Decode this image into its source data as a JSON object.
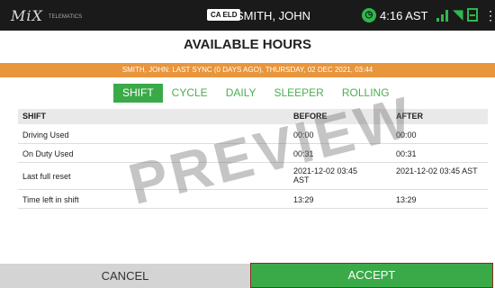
{
  "status_bar": {
    "logo_text": "MiX",
    "logo_sub": "TELEMATICS",
    "eld_badge": "CA ELD",
    "driver_name": "SMITH, JOHN",
    "time": "4:16 AST",
    "icons": [
      "clock-icon",
      "signal-icon",
      "wifi-icon",
      "document-icon",
      "menu-icon"
    ]
  },
  "page_title": "AVAILABLE HOURS",
  "sync_banner": "SMITH, JOHN: LAST SYNC (0 DAYS AGO), THURSDAY, 02 DEC 2021, 03:44",
  "tabs": [
    {
      "label": "SHIFT",
      "active": true
    },
    {
      "label": "CYCLE",
      "active": false
    },
    {
      "label": "DAILY",
      "active": false
    },
    {
      "label": "SLEEPER",
      "active": false
    },
    {
      "label": "ROLLING",
      "active": false
    }
  ],
  "table": {
    "headers": [
      "SHIFT",
      "BEFORE",
      "AFTER"
    ],
    "rows": [
      [
        "Driving Used",
        "00:00",
        "00:00"
      ],
      [
        "On Duty Used",
        "00:31",
        "00:31"
      ],
      [
        "Last full reset",
        "2021-12-02 03:45 AST",
        "2021-12-02 03:45 AST"
      ],
      [
        "Time left in shift",
        "13:29",
        "13:29"
      ]
    ]
  },
  "watermark": "PREVIEW",
  "buttons": {
    "cancel": "CANCEL",
    "accept": "ACCEPT"
  },
  "colors": {
    "accent_green": "#3aaa48",
    "banner_orange": "#e8953b",
    "status_bar": "#1a1a1a"
  }
}
